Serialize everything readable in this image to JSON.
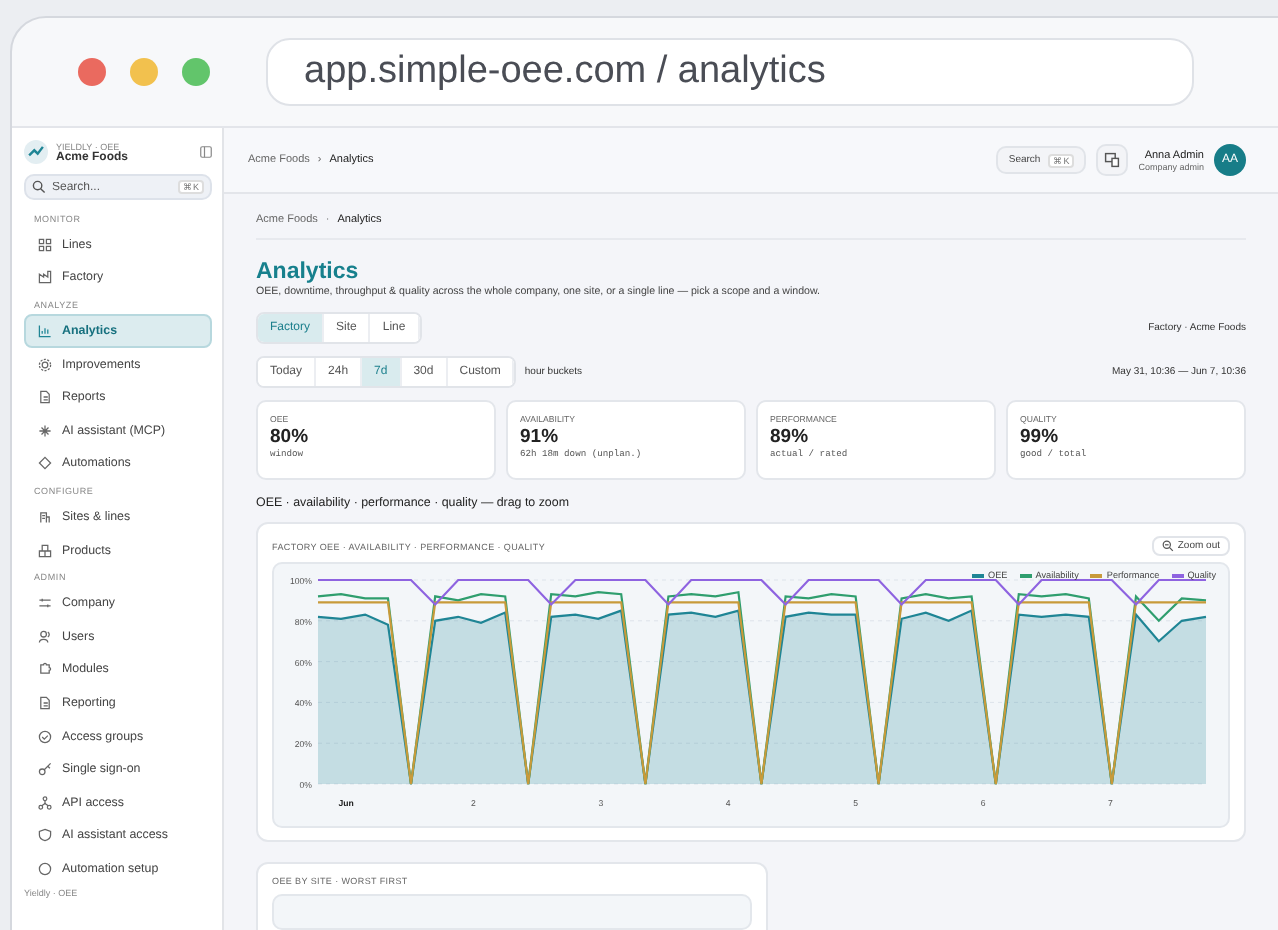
{
  "browser": {
    "url": "app.simple-oee.com / analytics"
  },
  "sidebar": {
    "brand": "YIELDLY · OEE",
    "company": "Acme Foods",
    "search": {
      "placeholder": "Search...",
      "shortcut": "⌘K"
    },
    "sections": [
      {
        "title": "MONITOR",
        "items": [
          {
            "label": "Lines",
            "selected": false
          },
          {
            "label": "Factory",
            "selected": false
          }
        ]
      },
      {
        "title": "ANALYZE",
        "items": [
          {
            "label": "Analytics",
            "selected": true
          },
          {
            "label": "Improvements",
            "selected": false
          },
          {
            "label": "Reports",
            "selected": false
          },
          {
            "label": "AI assistant (MCP)",
            "selected": false
          },
          {
            "label": "Automations",
            "selected": false
          }
        ]
      },
      {
        "title": "CONFIGURE",
        "items": [
          {
            "label": "Sites & lines",
            "selected": false
          },
          {
            "label": "Products",
            "selected": false
          }
        ]
      },
      {
        "title": "ADMIN",
        "items": [
          {
            "label": "Company",
            "selected": false
          },
          {
            "label": "Users",
            "selected": false
          },
          {
            "label": "Modules",
            "selected": false
          },
          {
            "label": "Reporting",
            "selected": false
          },
          {
            "label": "Access groups",
            "selected": false
          },
          {
            "label": "Single sign-on",
            "selected": false
          },
          {
            "label": "API access",
            "selected": false
          },
          {
            "label": "AI assistant access",
            "selected": false
          },
          {
            "label": "Automation setup",
            "selected": false
          }
        ]
      }
    ],
    "footer": "Yieldly · OEE"
  },
  "header": {
    "breadcrumb": [
      "Acme Foods",
      "Analytics"
    ],
    "breadcrumb_separator": "›",
    "search": {
      "label": "Search",
      "shortcut": "⌘K"
    },
    "user": {
      "name": "Anna Admin",
      "role": "Company admin",
      "initials": "AA"
    }
  },
  "page": {
    "breadcrumb": [
      "Acme Foods",
      "Analytics"
    ],
    "breadcrumb_separator": "·",
    "title": "Analytics",
    "subtitle": "OEE, downtime, throughput & quality across the whole company, one site, or a single line — pick a scope and a window.",
    "scopes": [
      {
        "label": "Factory",
        "selected": true
      },
      {
        "label": "Site",
        "selected": false
      },
      {
        "label": "Line",
        "selected": false
      }
    ],
    "scope_label": "Factory · Acme Foods",
    "ranges": [
      {
        "label": "Today",
        "selected": false
      },
      {
        "label": "24h",
        "selected": false
      },
      {
        "label": "7d",
        "selected": true
      },
      {
        "label": "30d",
        "selected": false
      },
      {
        "label": "Custom",
        "selected": false
      }
    ],
    "bucket_label": "hour buckets",
    "window_label": "May 31, 10:36 — Jun 7, 10:36",
    "kpis": [
      {
        "label": "OEE",
        "value": "80%",
        "note": "window"
      },
      {
        "label": "AVAILABILITY",
        "value": "91%",
        "note": "62h 18m down (unplan.)"
      },
      {
        "label": "PERFORMANCE",
        "value": "89%",
        "note": "actual / rated"
      },
      {
        "label": "QUALITY",
        "value": "99%",
        "note": "good / total"
      }
    ],
    "section_title": "OEE · availability · performance · quality — drag to zoom",
    "chart_card": {
      "title": "FACTORY OEE · AVAILABILITY · PERFORMANCE · QUALITY",
      "zoom_button": "Zoom out",
      "chart_data": {
        "type": "line",
        "x": [
          0.78,
          0.96,
          1.15,
          1.33,
          1.51,
          1.7,
          1.88,
          2.06,
          2.25,
          2.43,
          2.61,
          2.8,
          2.98,
          3.16,
          3.35,
          3.53,
          3.71,
          3.9,
          4.08,
          4.26,
          4.45,
          4.63,
          4.81,
          5,
          5.18,
          5.36,
          5.55,
          5.73,
          5.91,
          6.1,
          6.28,
          6.46,
          6.65,
          6.83,
          7.01,
          7.2,
          7.38,
          7.56,
          7.75
        ],
        "xlim": [
          0.78,
          7.75
        ],
        "ylim": [
          0,
          100
        ],
        "grid": true,
        "legend": true,
        "yticks": [
          {
            "value": 0,
            "label": "0%"
          },
          {
            "value": 20,
            "label": "20%"
          },
          {
            "value": 40,
            "label": "40%"
          },
          {
            "value": 60,
            "label": "60%"
          },
          {
            "value": 80,
            "label": "80%"
          },
          {
            "value": 100,
            "label": "100%"
          }
        ],
        "xticks": [
          {
            "value": 1,
            "label": "Jun"
          },
          2,
          3,
          4,
          5,
          6,
          7
        ],
        "series": [
          {
            "name": "OEE",
            "color": "#1f8595",
            "values": [
              82,
              81,
              83,
              78,
              0,
              80,
              82,
              79,
              84,
              0,
              82,
              83,
              81,
              85,
              0,
              83,
              84,
              82,
              85,
              0,
              82,
              84,
              83,
              83,
              0,
              81,
              84,
              80,
              85,
              0,
              83,
              82,
              83,
              82,
              0,
              83,
              70,
              80,
              82
            ]
          },
          {
            "name": "Availability",
            "color": "#2f9e6e",
            "values": [
              92,
              93,
              91,
              91,
              0,
              92,
              90,
              93,
              92,
              0,
              93,
              92,
              94,
              93,
              0,
              92,
              93,
              92,
              94,
              0,
              92,
              91,
              93,
              92,
              0,
              91,
              93,
              91,
              92,
              0,
              93,
              92,
              93,
              91,
              0,
              92,
              80,
              91,
              90
            ]
          },
          {
            "name": "Performance",
            "color": "#c89a3a",
            "values": [
              89,
              89,
              89,
              89,
              0,
              89,
              89,
              89,
              89,
              0,
              89,
              89,
              89,
              89,
              0,
              89,
              89,
              89,
              89,
              0,
              89,
              89,
              89,
              89,
              0,
              89,
              89,
              89,
              89,
              0,
              89,
              89,
              89,
              89,
              0,
              89,
              89,
              89,
              89
            ]
          },
          {
            "name": "Quality",
            "color": "#8e63e0",
            "values": [
              100,
              100,
              100,
              100,
              100,
              88,
              100,
              100,
              100,
              100,
              88,
              100,
              100,
              100,
              100,
              88,
              100,
              100,
              100,
              100,
              88,
              100,
              100,
              100,
              100,
              88,
              100,
              100,
              100,
              100,
              88,
              100,
              100,
              100,
              100,
              88,
              100,
              100,
              100
            ]
          }
        ]
      }
    },
    "site_card": {
      "title": "OEE BY SITE · WORST FIRST"
    }
  }
}
